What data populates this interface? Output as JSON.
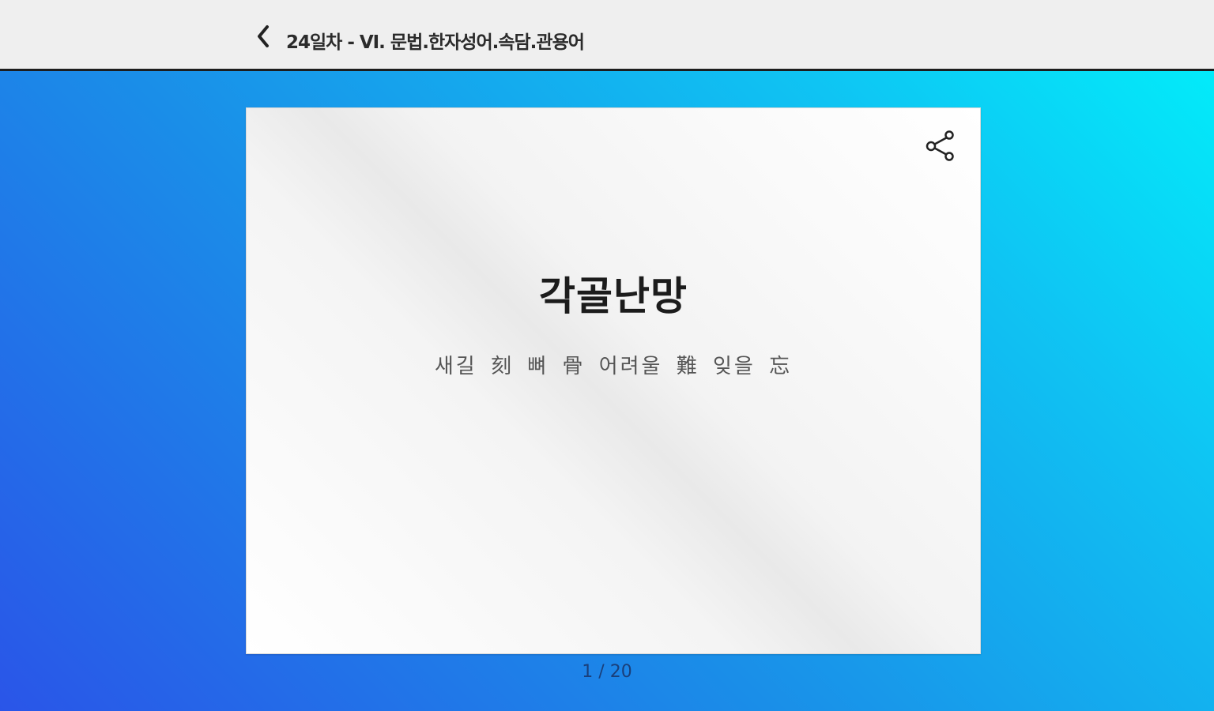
{
  "header": {
    "back_icon": "chevron-left-icon",
    "title": "24일차 - Ⅵ. 문법.한자성어.속담.관용어"
  },
  "card": {
    "term": "각골난망",
    "meaning": "새길 刻 뼈 骨 어려울 難 잊을 忘",
    "share_icon": "share-icon"
  },
  "pagination": {
    "counter": "1 / 20"
  },
  "colors": {
    "background_gradient_start": "#2a55e8",
    "background_gradient_end": "#00f2fb",
    "header_bg": "#efefef"
  }
}
